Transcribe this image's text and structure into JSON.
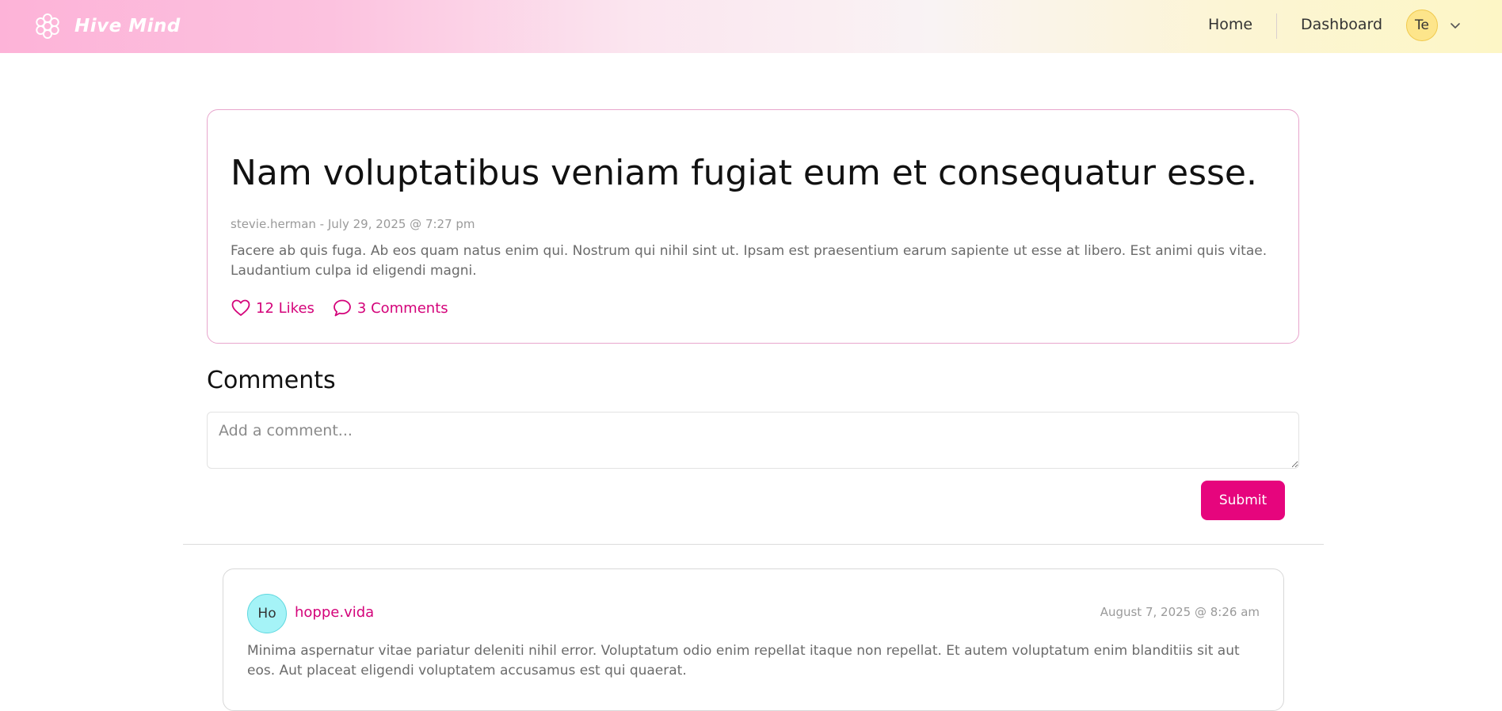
{
  "header": {
    "brand": "Hive Mind",
    "logo_icon": "flower-hex-icon",
    "nav": {
      "home": "Home",
      "dashboard": "Dashboard"
    },
    "user_initials": "Te",
    "menu_icon": "chevron-down-icon"
  },
  "post": {
    "title": "Nam voluptatibus veniam fugiat eum et consequatur esse.",
    "author": "stevie.herman",
    "date": "July 29, 2025 @ 7:27 pm",
    "meta": "stevie.herman - July 29, 2025 @ 7:27 pm",
    "body": "Facere ab quis fuga. Ab eos quam natus enim qui. Nostrum qui nihil sint ut. Ipsam est praesentium earum sapiente ut esse at libero. Est animi quis vitae. Laudantium culpa id eligendi magni.",
    "likes_label": "12 Likes",
    "comments_label": "3 Comments"
  },
  "comments_section": {
    "heading": "Comments",
    "input_placeholder": "Add a comment...",
    "submit_label": "Submit"
  },
  "comments": [
    {
      "initials": "Ho",
      "username": "hoppe.vida",
      "date": "August 7, 2025 @ 8:26 am",
      "body": "Minima aspernatur vitae pariatur deleniti nihil error. Voluptatum odio enim repellat itaque non repellat. Et autem voluptatum enim blanditiis sit aut eos. Aut placeat eligendi voluptatem accusamus est qui quaerat."
    }
  ],
  "colors": {
    "accent": "#e6057d",
    "link": "#d4037a",
    "header_gradient_left": "#fdb3d8",
    "header_gradient_right": "#fdf6c6",
    "post_border": "#e8a6cd"
  }
}
